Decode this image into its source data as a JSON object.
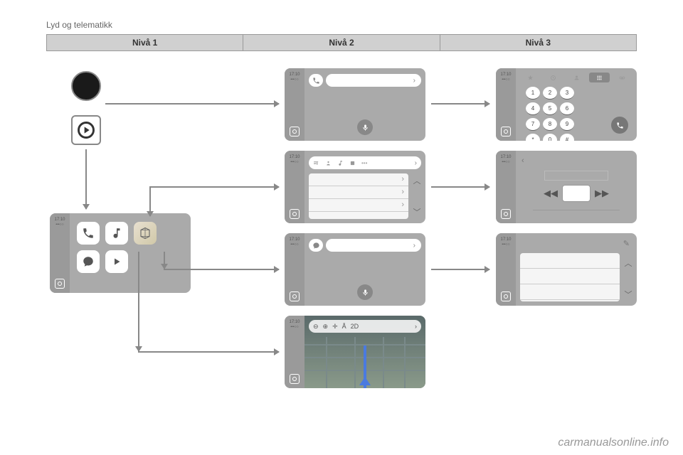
{
  "header": {
    "title": "Lyd og telematikk"
  },
  "table": {
    "cols": [
      "Nivå 1",
      "Nivå 2",
      "Nivå 3"
    ]
  },
  "time": "17:10",
  "dots": "•••○○",
  "map_label": "2D",
  "keypad": [
    "1",
    "2",
    "3",
    "4",
    "5",
    "6",
    "7",
    "8",
    "9",
    "*",
    "0",
    "#"
  ],
  "chevron": "›",
  "chevron_l": "‹",
  "up": "︿",
  "down": "﹀",
  "rew": "◀◀",
  "fwd": "▶▶",
  "pencil": "✎",
  "zoom_out": "⊖",
  "zoom_in": "⊕",
  "center": "✛",
  "north": "Å",
  "watermark": "carmanualsonline.info"
}
